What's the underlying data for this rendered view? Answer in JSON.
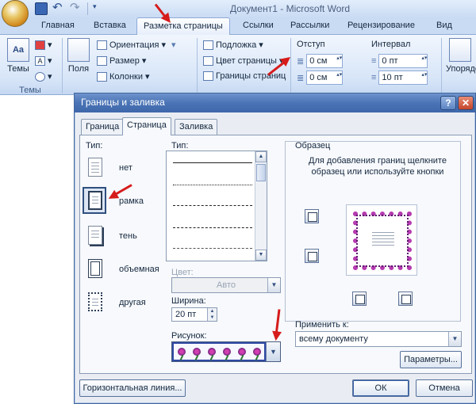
{
  "window": {
    "title": "Документ1 - Microsoft Word"
  },
  "tabs": [
    "Главная",
    "Вставка",
    "Разметка страницы",
    "Ссылки",
    "Рассылки",
    "Рецензирование",
    "Вид"
  ],
  "ribbon": {
    "themes": {
      "label": "Темы",
      "group": "Темы"
    },
    "fields_label": "Поля",
    "orientation": "Ориентация",
    "size": "Размер",
    "columns": "Колонки",
    "watermark": "Подложка",
    "page_color": "Цвет страницы",
    "page_borders": "Границы страниц",
    "indent": {
      "label": "Отступ",
      "left": "0 см",
      "right": "0 см"
    },
    "spacing": {
      "label": "Интервал",
      "before": "0 пт",
      "after": "10 пт"
    },
    "arrange": "Упорядо"
  },
  "dialog": {
    "title": "Границы и заливка",
    "help": "?",
    "close": "✕",
    "tabs": [
      "Граница",
      "Страница",
      "Заливка"
    ],
    "type_label": "Тип:",
    "types": [
      "нет",
      "рамка",
      "тень",
      "объемная",
      "другая"
    ],
    "style_label": "Тип:",
    "color_label": "Цвет:",
    "color_value": "Авто",
    "width_label": "Ширина:",
    "width_value": "20 пт",
    "art_label": "Рисунок:",
    "preview_label": "Образец",
    "preview_hint": "Для добавления границ щелкните образец или используйте кнопки",
    "apply_label": "Применить к:",
    "apply_value": "всему документу",
    "options_button": "Параметры...",
    "hline_button": "Горизонтальная линия...",
    "ok_button": "ОК",
    "cancel_button": "Отмена"
  },
  "colors": {
    "annotation_arrow": "#d61b1b",
    "dialog_title": "#4a74b6"
  }
}
